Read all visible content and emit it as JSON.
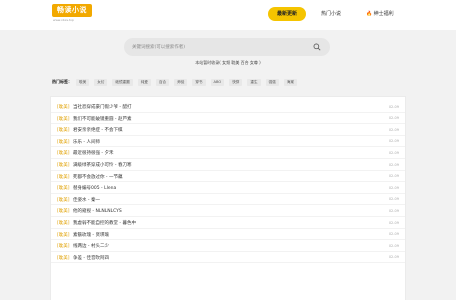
{
  "header": {
    "logo_text": "畅读小说",
    "logo_url": "www.xbxs.top",
    "nav": [
      {
        "label": "最新更新"
      },
      {
        "label": "热门小说"
      },
      {
        "label": "绅士福利"
      }
    ],
    "accent_color": "#f5c400"
  },
  "search": {
    "placeholder": "关键词搜索(可以搜索作者)",
    "note": "本站暂时收录( 女频 耽美 百合 女尊 )"
  },
  "tags": {
    "label": "热门标签：",
    "items": [
      "耽美",
      "女幻",
      "破镜重圆",
      "纯爱",
      "百合",
      "师徒",
      "穿书",
      "ABO",
      "快穿",
      "重生",
      "强强",
      "海棠"
    ]
  },
  "list": [
    {
      "category": "[耽美]",
      "title": "当社恐穿成豪门假少爷 - 醋打",
      "time": "02-09"
    },
    {
      "category": "[耽美]",
      "title": "我们不可能破镜重圆 - 赵芦素",
      "time": "02-09"
    },
    {
      "category": "[耽美]",
      "title": "君安亲亲绝症 - 不会下棋",
      "time": "02-09"
    },
    {
      "category": "[耽美]",
      "title": "乐乐 - 人间师",
      "time": "02-09"
    },
    {
      "category": "[耽美]",
      "title": "最近很持很强 - 夕禾",
      "time": "02-09"
    },
    {
      "category": "[耽美]",
      "title": "满级绿茶穿成小可怜 - 春刀寒",
      "time": "02-09"
    },
    {
      "category": "[耽美]",
      "title": "死都不会放过你 - 一节藕",
      "time": "02-09"
    },
    {
      "category": "[耽美]",
      "title": "替身编号005 - Llena",
      "time": "02-09"
    },
    {
      "category": "[耽美]",
      "title": "佳姿水 - 秦一",
      "time": "02-09"
    },
    {
      "category": "[耽美]",
      "title": "他的窥视 - NLNLNLCYS",
      "time": "02-09"
    },
    {
      "category": "[耽美]",
      "title": "我虚弱不能自控的教堂 - 暮色中",
      "time": "02-09"
    },
    {
      "category": "[耽美]",
      "title": "素骸玫瑰 - 贤瑛瑜",
      "time": "02-09"
    },
    {
      "category": "[耽美]",
      "title": "线两边 - 村头二少",
      "time": "02-09"
    },
    {
      "category": "[耽美]",
      "title": "争差 - 佳音吹阿四",
      "time": "02-09"
    }
  ]
}
